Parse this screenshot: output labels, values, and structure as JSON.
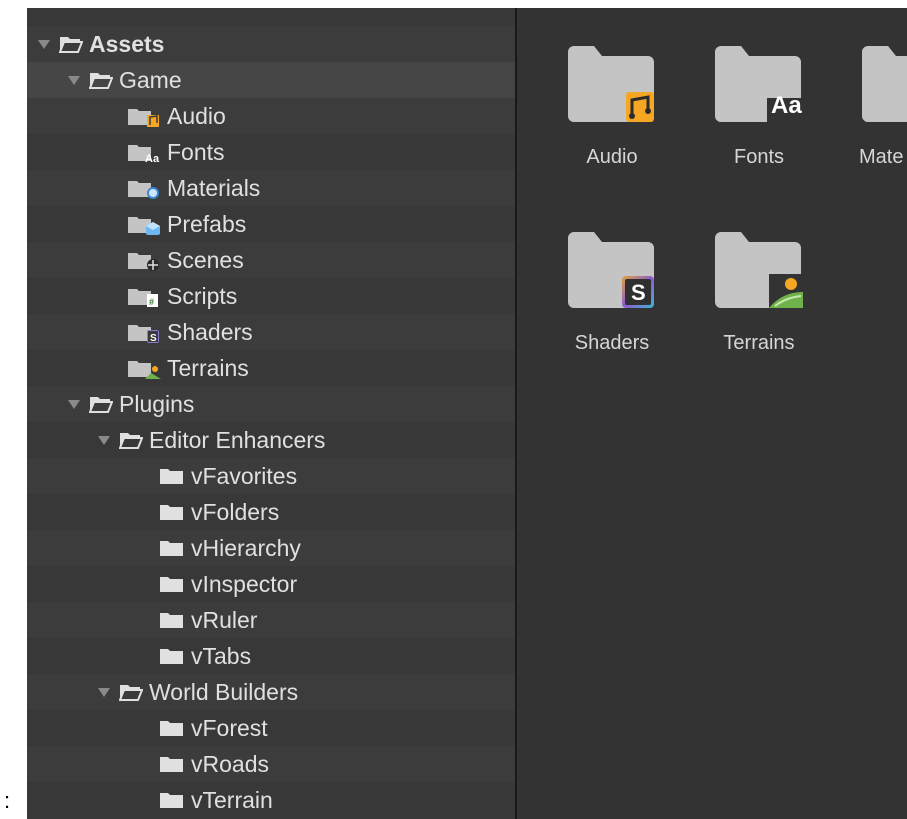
{
  "bullet": ":",
  "tree": {
    "assets": {
      "label": "Assets"
    },
    "game": {
      "label": "Game"
    },
    "game_items": [
      {
        "label": "Audio",
        "icon": "audio-folder-icon"
      },
      {
        "label": "Fonts",
        "icon": "fonts-folder-icon"
      },
      {
        "label": "Materials",
        "icon": "materials-folder-icon"
      },
      {
        "label": "Prefabs",
        "icon": "prefabs-folder-icon"
      },
      {
        "label": "Scenes",
        "icon": "scenes-folder-icon"
      },
      {
        "label": "Scripts",
        "icon": "scripts-folder-icon"
      },
      {
        "label": "Shaders",
        "icon": "shaders-folder-icon"
      },
      {
        "label": "Terrains",
        "icon": "terrains-folder-icon"
      }
    ],
    "plugins": {
      "label": "Plugins"
    },
    "editor_enhancers": {
      "label": "Editor Enhancers"
    },
    "editor_items": [
      {
        "label": "vFavorites"
      },
      {
        "label": "vFolders"
      },
      {
        "label": "vHierarchy"
      },
      {
        "label": "vInspector"
      },
      {
        "label": "vRuler"
      },
      {
        "label": "vTabs"
      }
    ],
    "world_builders": {
      "label": "World Builders"
    },
    "world_items": [
      {
        "label": "vForest"
      },
      {
        "label": "vRoads"
      },
      {
        "label": "vTerrain"
      }
    ]
  },
  "grid": {
    "tiles": [
      {
        "label": "Audio",
        "icon": "audio-folder-icon"
      },
      {
        "label": "Fonts",
        "icon": "fonts-folder-icon"
      },
      {
        "label": "Mate",
        "icon": "materials-folder-icon"
      },
      {
        "label": "Shaders",
        "icon": "shaders-folder-icon"
      },
      {
        "label": "Terrains",
        "icon": "terrains-folder-icon"
      }
    ],
    "fonts_badge": "Aa",
    "shaders_badge": "S"
  },
  "colors": {
    "tree_bg": "#383838",
    "row_alt": "#3c3c3c",
    "selected": "#464646",
    "grid_bg": "#333333",
    "folder": "#c4c4c4",
    "text": "#e0e0e0",
    "audio_accent": "#f5a623",
    "terrain_green": "#6fb24a"
  }
}
